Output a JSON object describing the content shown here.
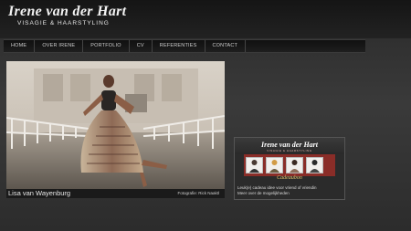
{
  "header": {
    "title": "Irene van der Hart",
    "subtitle": "VISAGIE  &  HAARSTYLING"
  },
  "nav": {
    "items": [
      {
        "label": "HOME"
      },
      {
        "label": "OVER IRENE"
      },
      {
        "label": "PORTFOLIO"
      },
      {
        "label": "CV"
      },
      {
        "label": "REFERENTIES"
      },
      {
        "label": "CONTACT"
      }
    ]
  },
  "feature": {
    "subject": "Lisa van Wayenburg",
    "credit": "Fotografie: Rick Naaktl"
  },
  "ad": {
    "title": "Irene van der Hart",
    "subtitle": "VISAGIE  &  HAARSTYLING",
    "script": "Cadeaubon",
    "line1": "Leuk(e) cadeau idee voor vriend of vriendin",
    "line2": "Meer over de mogelijkheden",
    "colors": {
      "band": "#8a2d28",
      "script": "#e5c16b"
    }
  }
}
